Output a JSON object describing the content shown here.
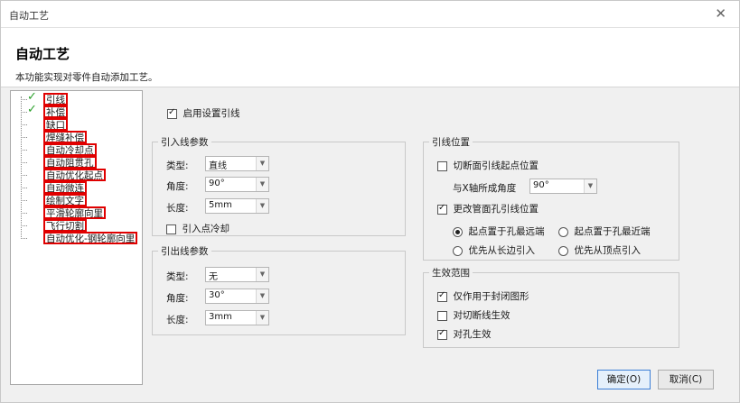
{
  "window": {
    "title": "自动工艺",
    "close_glyph": "✕"
  },
  "header": {
    "title": "自动工艺",
    "description": "本功能实现对零件自动添加工艺。"
  },
  "tree": {
    "items": [
      {
        "label": "引线",
        "checked": true
      },
      {
        "label": "补偿",
        "checked": true
      },
      {
        "label": "缺口",
        "checked": false
      },
      {
        "label": "焊缝补偿",
        "checked": false
      },
      {
        "label": "自动冷却点",
        "checked": false
      },
      {
        "label": "自动阻贯孔",
        "checked": false
      },
      {
        "label": "自动优化起点",
        "checked": false
      },
      {
        "label": "自动微连",
        "checked": false
      },
      {
        "label": "绘制文字",
        "checked": false
      },
      {
        "label": "平滑轮廓向里",
        "checked": false
      },
      {
        "label": "飞行切割",
        "checked": false
      },
      {
        "label": "自动优化-钢轮廓向里",
        "checked": false
      }
    ]
  },
  "enable_lead": {
    "label": "启用设置引线",
    "checked": true
  },
  "lead_in": {
    "legend": "引入线参数",
    "type_label": "类型:",
    "type_value": "直线",
    "angle_label": "角度:",
    "angle_value": "90°",
    "length_label": "长度:",
    "length_value": "5mm",
    "cooling_label": "引入点冷却",
    "cooling_checked": false
  },
  "lead_out": {
    "legend": "引出线参数",
    "type_label": "类型:",
    "type_value": "无",
    "angle_label": "角度:",
    "angle_value": "30°",
    "length_label": "长度:",
    "length_value": "3mm"
  },
  "lead_position": {
    "legend": "引线位置",
    "cut_start_label": "切断面引线起点位置",
    "cut_start_checked": false,
    "x_angle_label": "与X轴所成角度",
    "x_angle_value": "90°",
    "change_tube_label": "更改管面孔引线位置",
    "change_tube_checked": true,
    "radio_far": "起点置于孔最远端",
    "radio_near": "起点置于孔最近端",
    "radio_long": "优先从长边引入",
    "radio_vertex": "优先从顶点引入",
    "selected_radio": "radio_far"
  },
  "effect_range": {
    "legend": "生效范围",
    "closed_label": "仅作用于封闭图形",
    "closed_checked": true,
    "cutline_label": "对切断线生效",
    "cutline_checked": false,
    "hole_label": "对孔生效",
    "hole_checked": true
  },
  "buttons": {
    "ok": "确定(O)",
    "cancel": "取消(C)"
  },
  "colors": {
    "highlight_border": "#e00000",
    "check_green": "#2aa02a",
    "primary_border": "#3c7fd6"
  },
  "icons": {
    "check": "check-icon",
    "dropdown": "chevron-down-icon",
    "close": "close-icon"
  }
}
